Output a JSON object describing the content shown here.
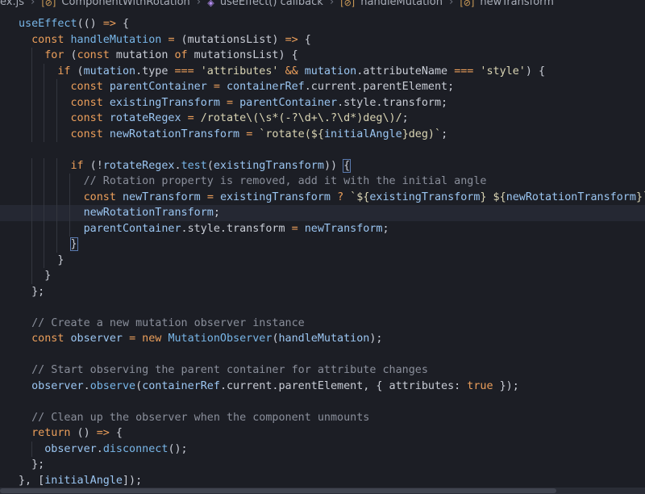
{
  "breadcrumb": {
    "file": "ex.js",
    "items": [
      "ComponentWithRotation",
      "useEffect() callback",
      "handleMutation",
      "newTransform"
    ]
  },
  "code": {
    "lines": [
      [
        [
          "fn",
          "useEffect"
        ],
        [
          "pn",
          "(() "
        ],
        [
          "op",
          "=>"
        ],
        [
          "pn",
          " {"
        ]
      ],
      [
        [
          "kw",
          "  const "
        ],
        [
          "fn",
          "handleMutation"
        ],
        [
          "pn",
          " "
        ],
        [
          "op",
          "="
        ],
        [
          "pn",
          " (mutationsList) "
        ],
        [
          "op",
          "=>"
        ],
        [
          "pn",
          " {"
        ]
      ],
      [
        [
          "kw",
          "    for"
        ],
        [
          "pn",
          " ("
        ],
        [
          "kw",
          "const"
        ],
        [
          "pn",
          " mutation "
        ],
        [
          "kw",
          "of"
        ],
        [
          "pn",
          " mutationsList) {"
        ]
      ],
      [
        [
          "kw",
          "      if"
        ],
        [
          "pn",
          " ("
        ],
        [
          "var",
          "mutation"
        ],
        [
          "pn",
          ".type "
        ],
        [
          "op",
          "==="
        ],
        [
          "str",
          " 'attributes'"
        ],
        [
          "pn",
          " "
        ],
        [
          "op",
          "&&"
        ],
        [
          "pn",
          " "
        ],
        [
          "var",
          "mutation"
        ],
        [
          "pn",
          ".attributeName "
        ],
        [
          "op",
          "==="
        ],
        [
          "str",
          " 'style'"
        ],
        [
          "pn",
          ") {"
        ]
      ],
      [
        [
          "kw",
          "        const "
        ],
        [
          "var",
          "parentContainer"
        ],
        [
          "pn",
          " "
        ],
        [
          "op",
          "="
        ],
        [
          "pn",
          " "
        ],
        [
          "var",
          "containerRef"
        ],
        [
          "pn",
          ".current.parentElement;"
        ]
      ],
      [
        [
          "kw",
          "        const "
        ],
        [
          "var",
          "existingTransform"
        ],
        [
          "pn",
          " "
        ],
        [
          "op",
          "="
        ],
        [
          "pn",
          " "
        ],
        [
          "var",
          "parentContainer"
        ],
        [
          "pn",
          ".style.transform;"
        ]
      ],
      [
        [
          "kw",
          "        const "
        ],
        [
          "var",
          "rotateRegex"
        ],
        [
          "pn",
          " "
        ],
        [
          "op",
          "="
        ],
        [
          "regex",
          " /rotate\\(\\s*(-?\\d+\\.?\\d*)deg\\)/"
        ],
        [
          "pn",
          ";"
        ]
      ],
      [
        [
          "kw",
          "        const "
        ],
        [
          "var",
          "newRotationTransform"
        ],
        [
          "pn",
          " "
        ],
        [
          "op",
          "="
        ],
        [
          "tpl",
          " `rotate(${"
        ],
        [
          "var",
          "initialAngle"
        ],
        [
          "tpl",
          "}deg)`"
        ],
        [
          "pn",
          ";"
        ]
      ],
      [
        [
          "pn",
          ""
        ]
      ],
      [
        [
          "kw",
          "        if"
        ],
        [
          "pn",
          " (!"
        ],
        [
          "var",
          "rotateRegex"
        ],
        [
          "pn",
          "."
        ],
        [
          "fn",
          "test"
        ],
        [
          "pn",
          "("
        ],
        [
          "var",
          "existingTransform"
        ],
        [
          "pn",
          ")) "
        ],
        [
          "brace",
          "{"
        ]
      ],
      [
        [
          "cm",
          "          // Rotation property is removed, add it with the initial angle"
        ]
      ],
      [
        [
          "kw",
          "          const "
        ],
        [
          "var",
          "newTransform"
        ],
        [
          "pn",
          " "
        ],
        [
          "op",
          "="
        ],
        [
          "pn",
          " "
        ],
        [
          "var",
          "existingTransform"
        ],
        [
          "pn",
          " "
        ],
        [
          "op",
          "?"
        ],
        [
          "tpl",
          " `${"
        ],
        [
          "var",
          "existingTransform"
        ],
        [
          "tpl",
          "} ${"
        ],
        [
          "var",
          "newRotationTransform"
        ],
        [
          "tpl",
          "}`"
        ],
        [
          "pn",
          " "
        ],
        [
          "op",
          ":"
        ]
      ],
      [
        [
          "var",
          "          newRotationTransform"
        ],
        [
          "pn",
          ";"
        ]
      ],
      [
        [
          "var",
          "          parentContainer"
        ],
        [
          "pn",
          ".style.transform "
        ],
        [
          "op",
          "="
        ],
        [
          "pn",
          " "
        ],
        [
          "var",
          "newTransform"
        ],
        [
          "pn",
          ";"
        ]
      ],
      [
        [
          "brace",
          "        }"
        ]
      ],
      [
        [
          "pn",
          "      }"
        ]
      ],
      [
        [
          "pn",
          "    }"
        ]
      ],
      [
        [
          "pn",
          "  };"
        ]
      ],
      [
        [
          "pn",
          ""
        ]
      ],
      [
        [
          "cm",
          "  // Create a new mutation observer instance"
        ]
      ],
      [
        [
          "kw",
          "  const "
        ],
        [
          "var",
          "observer"
        ],
        [
          "pn",
          " "
        ],
        [
          "op",
          "="
        ],
        [
          "kw",
          " new "
        ],
        [
          "fn",
          "MutationObserver"
        ],
        [
          "pn",
          "("
        ],
        [
          "var",
          "handleMutation"
        ],
        [
          "pn",
          ");"
        ]
      ],
      [
        [
          "pn",
          ""
        ]
      ],
      [
        [
          "cm",
          "  // Start observing the parent container for attribute changes"
        ]
      ],
      [
        [
          "var",
          "  observer"
        ],
        [
          "pn",
          "."
        ],
        [
          "fn",
          "observe"
        ],
        [
          "pn",
          "("
        ],
        [
          "var",
          "containerRef"
        ],
        [
          "pn",
          ".current.parentElement, { attributes: "
        ],
        [
          "bool",
          "true"
        ],
        [
          "pn",
          " });"
        ]
      ],
      [
        [
          "pn",
          ""
        ]
      ],
      [
        [
          "cm",
          "  // Clean up the observer when the component unmounts"
        ]
      ],
      [
        [
          "kw",
          "  return"
        ],
        [
          "pn",
          " () "
        ],
        [
          "op",
          "=>"
        ],
        [
          "pn",
          " {"
        ]
      ],
      [
        [
          "var",
          "    observer"
        ],
        [
          "pn",
          "."
        ],
        [
          "fn",
          "disconnect"
        ],
        [
          "pn",
          "();"
        ]
      ],
      [
        [
          "pn",
          "  };"
        ]
      ],
      [
        [
          "pn",
          "}, ["
        ],
        [
          "var",
          "initialAngle"
        ],
        [
          "pn",
          "]);"
        ]
      ]
    ]
  }
}
